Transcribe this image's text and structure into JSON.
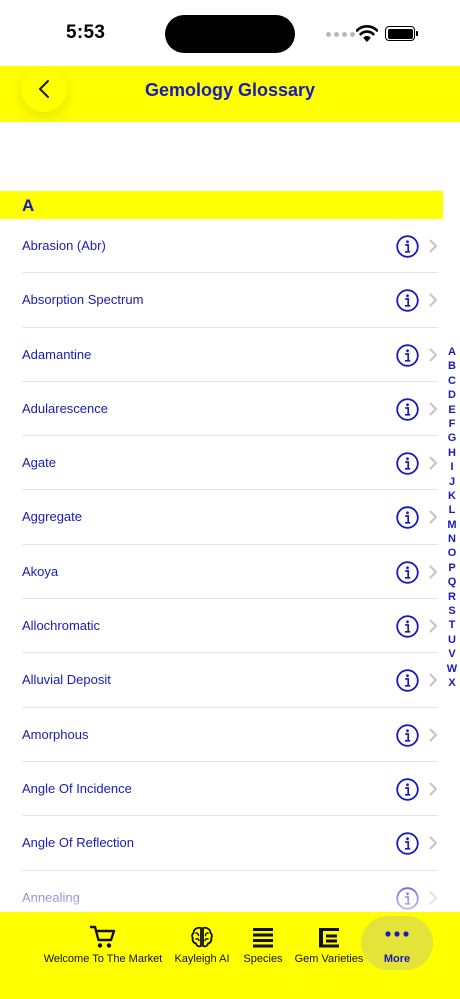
{
  "status_bar": {
    "time": "5:53"
  },
  "nav": {
    "title": "Gemology Glossary",
    "back_icon": "chevron-left-icon"
  },
  "section": {
    "letter": "A"
  },
  "items": [
    {
      "label": "Abrasion (Abr)"
    },
    {
      "label": "Absorption Spectrum"
    },
    {
      "label": "Adamantine"
    },
    {
      "label": "Adularescence"
    },
    {
      "label": "Agate"
    },
    {
      "label": "Aggregate"
    },
    {
      "label": "Akoya"
    },
    {
      "label": "Allochromatic"
    },
    {
      "label": "Alluvial Deposit"
    },
    {
      "label": "Amorphous"
    },
    {
      "label": "Angle Of Incidence"
    },
    {
      "label": "Angle Of Reflection"
    },
    {
      "label": "Annealing"
    }
  ],
  "index_letters": [
    "A",
    "B",
    "C",
    "D",
    "E",
    "F",
    "G",
    "H",
    "I",
    "J",
    "K",
    "L",
    "M",
    "N",
    "O",
    "P",
    "Q",
    "R",
    "S",
    "T",
    "U",
    "V",
    "W",
    "X"
  ],
  "tabs": [
    {
      "label": "Welcome To The Market",
      "icon": "cart-icon"
    },
    {
      "label": "Kayleigh AI",
      "icon": "brain-icon"
    },
    {
      "label": "Species",
      "icon": "list-icon"
    },
    {
      "label": "Gem Varieties",
      "icon": "text-format-icon"
    },
    {
      "label": "More",
      "icon": "ellipsis-icon",
      "selected": true
    }
  ],
  "colors": {
    "accent": "#ffff00",
    "text": "#1a1ab8",
    "divider": "#e4e4e4"
  }
}
